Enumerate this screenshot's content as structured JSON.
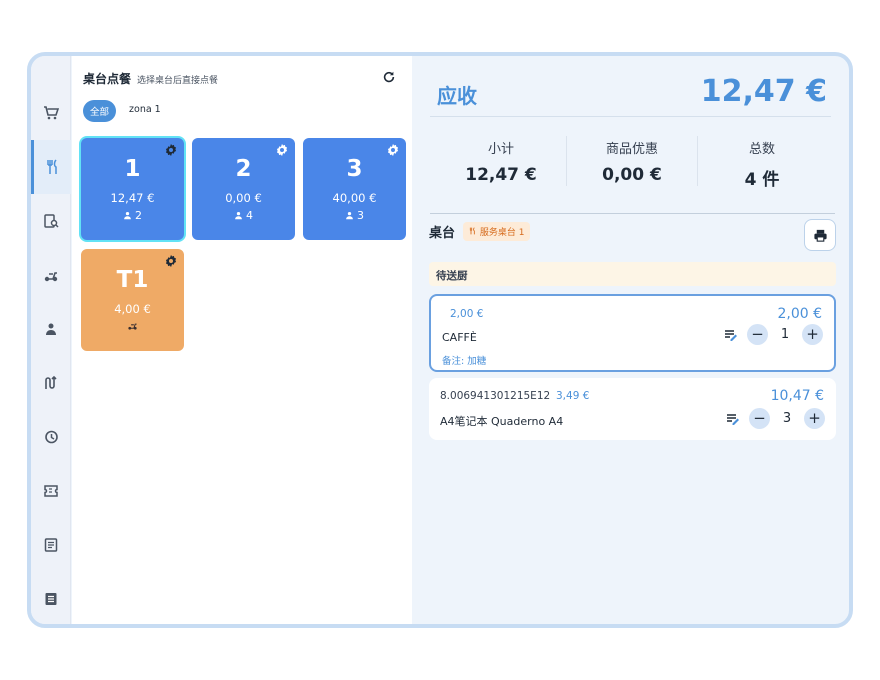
{
  "left": {
    "title": "桌台点餐",
    "subtitle": "选择桌台后直接点餐",
    "filters": [
      "全部",
      "zona 1"
    ],
    "tables": [
      {
        "name": "1",
        "amount": "12,47 €",
        "people": "2",
        "color": "blue",
        "selected": true
      },
      {
        "name": "2",
        "amount": "0,00 €",
        "people": "4",
        "color": "blue",
        "selected": false
      },
      {
        "name": "3",
        "amount": "40,00 €",
        "people": "3",
        "color": "blue",
        "selected": false
      },
      {
        "name": "T1",
        "amount": "4,00 €",
        "people": "",
        "color": "orange",
        "selected": false
      }
    ]
  },
  "right": {
    "title": "应收",
    "total": "12,47 €",
    "stats": [
      {
        "label": "小计",
        "value": "12,47 €"
      },
      {
        "label": "商品优惠",
        "value": "0,00 €"
      },
      {
        "label": "总数",
        "value": "4 件"
      }
    ],
    "table_label": "桌台",
    "table_tag": "服务桌台 1",
    "pending_label": "待送厨",
    "items": [
      {
        "code": "",
        "price": "2,00 €",
        "line_total": "2,00 €",
        "name": "CAFFÈ",
        "qty": "1",
        "note": "备注: 加糖"
      },
      {
        "code": "8.006941301215E12",
        "price": "3,49 €",
        "line_total": "10,47 €",
        "name": "A4笔记本 Quaderno A4",
        "qty": "3",
        "note": ""
      }
    ]
  },
  "colors": {
    "accent": "#4a90d9",
    "table_blue": "#4a86e8",
    "table_orange": "#efaa66",
    "selected_outline": "#62e2f5"
  },
  "icons": {
    "rail": [
      "cart-icon",
      "utensils-icon",
      "order-search-icon",
      "scooter-icon",
      "users-icon",
      "route-icon",
      "history-icon",
      "ticket-icon",
      "document-icon",
      "list-icon"
    ]
  }
}
